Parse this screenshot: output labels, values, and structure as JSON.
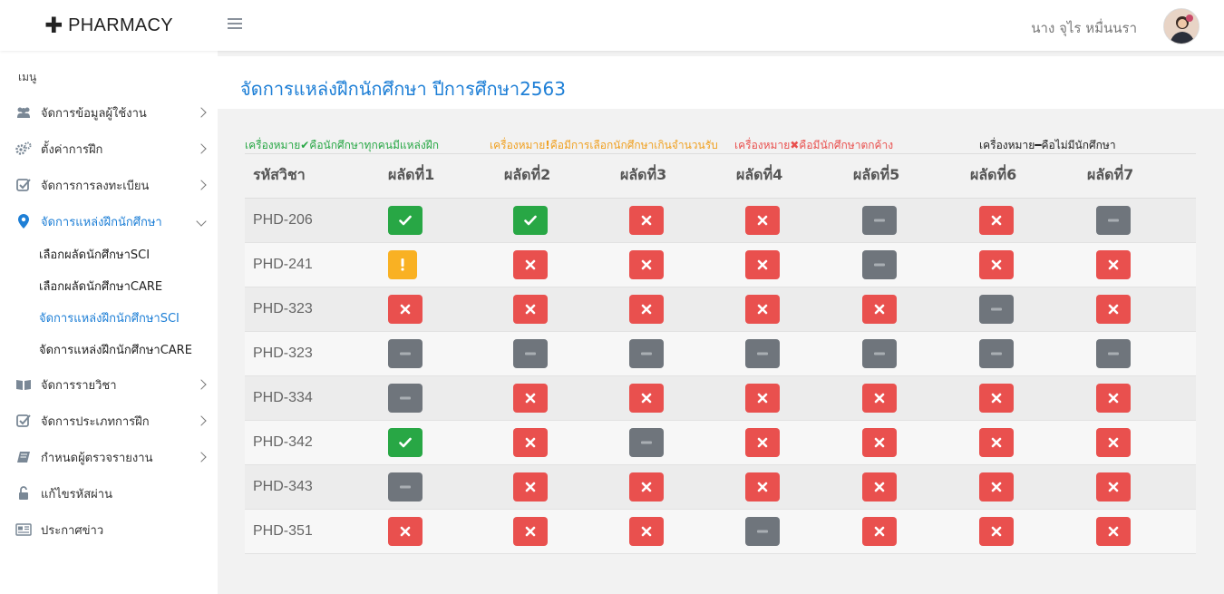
{
  "brand": {
    "plus": "✚",
    "name": "PHARMACY"
  },
  "user": {
    "name": "นาง จุไร หมื่นนรา"
  },
  "sidebar": {
    "heading": "เมนู",
    "items": [
      {
        "label": "จัดการข้อมูลผู้ใช้งาน",
        "icon": "users-icon"
      },
      {
        "label": "ตั้งค่าการฝึก",
        "icon": "gears-icon"
      },
      {
        "label": "จัดการการลงทะเบียน",
        "icon": "check-square-icon"
      },
      {
        "label": "จัดการแหล่งฝึกนักศึกษา",
        "icon": "map-marker-icon"
      },
      {
        "label": "จัดการรายวิชา",
        "icon": "book-icon"
      },
      {
        "label": "จัดการประเภทการฝึก",
        "icon": "check-square-icon"
      },
      {
        "label": "กำหนดผู้ตรวจรายงาน",
        "icon": "book-icon"
      },
      {
        "label": "แก้ไขรหัสผ่าน",
        "icon": "unlock-icon"
      },
      {
        "label": "ประกาศข่าว",
        "icon": "newspaper-icon"
      }
    ],
    "subitems": [
      {
        "label": "เลือกผลัดนักศึกษาSCI"
      },
      {
        "label": "เลือกผลัดนักศึกษาCARE"
      },
      {
        "label": "จัดการแหล่งฝึกนักศึกษาSCI"
      },
      {
        "label": "จัดการแหล่งฝึกนักศึกษาCARE"
      }
    ]
  },
  "page": {
    "title": "จัดการแหล่งฝึกนักศึกษา ปีการศึกษา2563"
  },
  "legend": [
    {
      "before": "เครื่องหมาย",
      "symbol": "✔",
      "after": "คือนักศึกษาทุกคนมีแหล่งฝึก",
      "color": "#28a745",
      "symbol_color": "#28a745"
    },
    {
      "before": "เครื่องหมาย",
      "symbol": "!",
      "after": "คือมีการเลือกนักศึกษาเกินจำนวนรับ",
      "color": "#f0a020",
      "symbol_color": "#f0a020"
    },
    {
      "before": "เครื่องหมาย",
      "symbol": "✖",
      "after": "คือมีนักศึกษาตกค้าง",
      "color": "#e9504e",
      "symbol_color": "#e9504e"
    },
    {
      "before": "เครื่องหมาย",
      "symbol": "━",
      "after": "คือไม่มีนักศึกษา",
      "color": "#222222",
      "symbol_color": "#222222"
    }
  ],
  "table": {
    "headers": [
      "รหัสวิชา",
      "ผลัดที่1",
      "ผลัดที่2",
      "ผลัดที่3",
      "ผลัดที่4",
      "ผลัดที่5",
      "ผลัดที่6",
      "ผลัดที่7"
    ],
    "rows": [
      {
        "code": "PHD-206",
        "status": [
          "pass",
          "pass",
          "fail",
          "fail",
          "none",
          "fail",
          "none"
        ]
      },
      {
        "code": "PHD-241",
        "status": [
          "over",
          "fail",
          "fail",
          "fail",
          "none",
          "fail",
          "fail"
        ]
      },
      {
        "code": "PHD-323",
        "status": [
          "fail",
          "fail",
          "fail",
          "fail",
          "fail",
          "none",
          "fail"
        ]
      },
      {
        "code": "PHD-323",
        "status": [
          "none",
          "none",
          "none",
          "none",
          "none",
          "none",
          "none"
        ]
      },
      {
        "code": "PHD-334",
        "status": [
          "none",
          "fail",
          "fail",
          "fail",
          "fail",
          "fail",
          "fail"
        ]
      },
      {
        "code": "PHD-342",
        "status": [
          "pass",
          "fail",
          "none",
          "fail",
          "fail",
          "fail",
          "fail"
        ]
      },
      {
        "code": "PHD-343",
        "status": [
          "none",
          "fail",
          "fail",
          "fail",
          "fail",
          "fail",
          "fail"
        ]
      },
      {
        "code": "PHD-351",
        "status": [
          "fail",
          "fail",
          "fail",
          "none",
          "fail",
          "fail",
          "fail"
        ]
      }
    ]
  },
  "colors": {
    "accent": "#1e7fd6",
    "pass": "#28a745",
    "over": "#f9b123",
    "fail": "#e9504e",
    "none": "#6f757c"
  }
}
